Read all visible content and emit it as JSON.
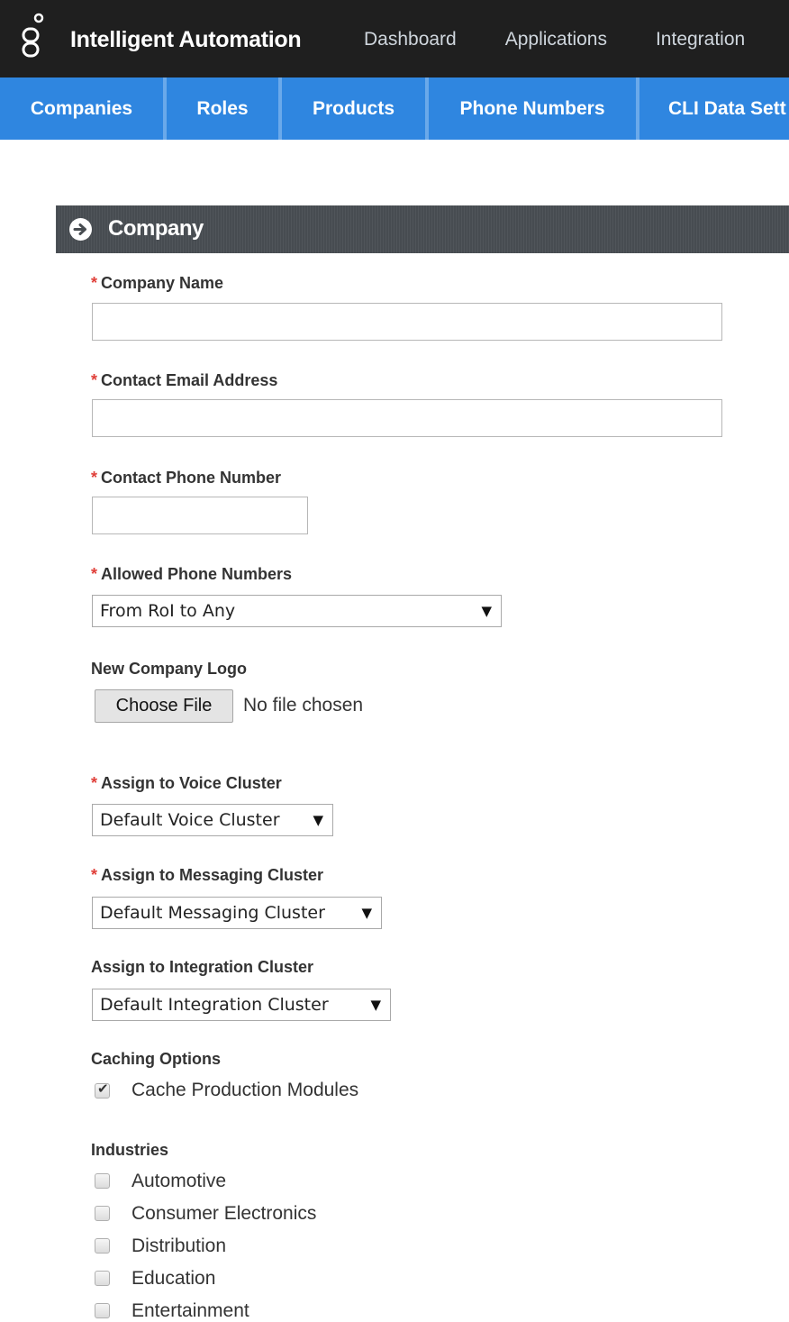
{
  "header": {
    "app_title": "Intelligent Automation",
    "nav": [
      "Dashboard",
      "Applications",
      "Integration"
    ]
  },
  "subnav": {
    "items": [
      "Companies",
      "Roles",
      "Products",
      "Phone Numbers",
      "CLI Data Sett"
    ]
  },
  "panel": {
    "title": "Company",
    "icon": "arrow-right-circle-icon"
  },
  "form": {
    "required_marker": "*",
    "company_name": {
      "label": "Company Name",
      "value": ""
    },
    "contact_email": {
      "label": "Contact Email Address",
      "value": ""
    },
    "contact_phone": {
      "label": "Contact Phone Number",
      "value": ""
    },
    "allowed_phone_numbers": {
      "label": "Allowed Phone Numbers",
      "selected": "From RoI to Any"
    },
    "company_logo": {
      "label": "New Company Logo",
      "button": "Choose File",
      "status": "No file chosen"
    },
    "voice_cluster": {
      "label": "Assign to Voice Cluster",
      "selected": "Default Voice Cluster"
    },
    "messaging_cluster": {
      "label": "Assign to Messaging Cluster",
      "selected": "Default Messaging Cluster"
    },
    "integration_cluster": {
      "label": "Assign to Integration Cluster",
      "selected": "Default Integration Cluster"
    },
    "caching": {
      "label": "Caching Options",
      "options": [
        {
          "label": "Cache Production Modules",
          "checked": true
        }
      ]
    },
    "industries": {
      "label": "Industries",
      "options": [
        {
          "label": "Automotive",
          "checked": false
        },
        {
          "label": "Consumer Electronics",
          "checked": false
        },
        {
          "label": "Distribution",
          "checked": false
        },
        {
          "label": "Education",
          "checked": false
        },
        {
          "label": "Entertainment",
          "checked": false
        }
      ]
    }
  },
  "colors": {
    "topbar": "#1f1f1f",
    "subnav": "#2f86e0",
    "panel_header": "#474c51",
    "required": "#e0403a"
  }
}
